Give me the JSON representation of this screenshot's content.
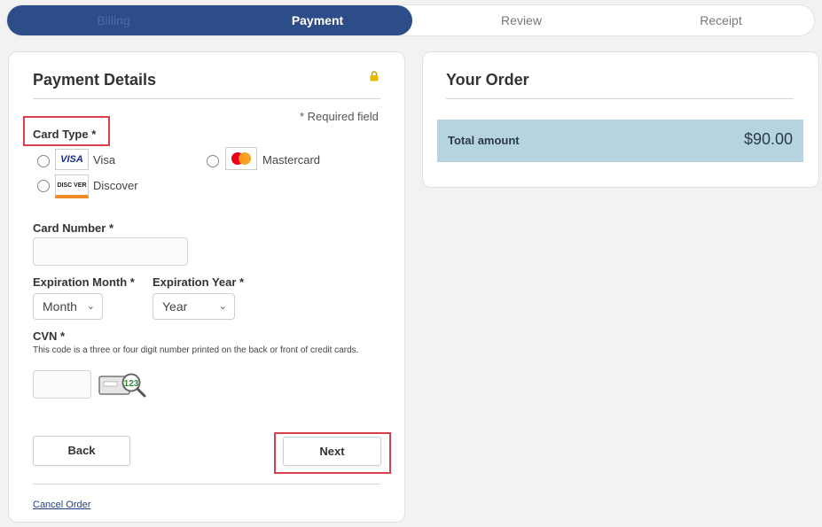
{
  "progress": {
    "steps": [
      {
        "label": "Billing"
      },
      {
        "label": "Payment"
      },
      {
        "label": "Review"
      },
      {
        "label": "Receipt"
      }
    ],
    "active_step": "Payment"
  },
  "payment_details": {
    "title": "Payment Details",
    "required_note": "* Required field",
    "card_type_label": "Card Type *",
    "card_options": [
      {
        "logo_text": "VISA",
        "label": "Visa",
        "selected": false
      },
      {
        "logo_text": "",
        "label": "Mastercard",
        "selected": false
      },
      {
        "logo_text": "DISC VER",
        "label": "Discover",
        "selected": false
      }
    ],
    "card_number_label": "Card Number *",
    "card_number_value": "",
    "expiration_month_label": "Expiration Month *",
    "expiration_month_value": "Month",
    "expiration_year_label": "Expiration Year *",
    "expiration_year_value": "Year",
    "cvn_label": "CVN *",
    "cvn_help": "This code is a three or four digit number printed on the back or front of credit cards.",
    "cvn_value": "",
    "cvn_image_text": "123",
    "back_label": "Back",
    "next_label": "Next",
    "cancel_label": "Cancel Order"
  },
  "order": {
    "title": "Your Order",
    "total_label": "Total amount",
    "total_value": "$90.00"
  },
  "colors": {
    "progress_active": "#2c4d87",
    "total_bar": "#b5d4df",
    "highlight": "#d9404a",
    "lock": "#e8b800"
  },
  "icons": [
    "lock-icon",
    "chevron-down-icon",
    "visa-logo",
    "mastercard-logo",
    "discover-logo",
    "cvn-card-magnifier-icon"
  ]
}
